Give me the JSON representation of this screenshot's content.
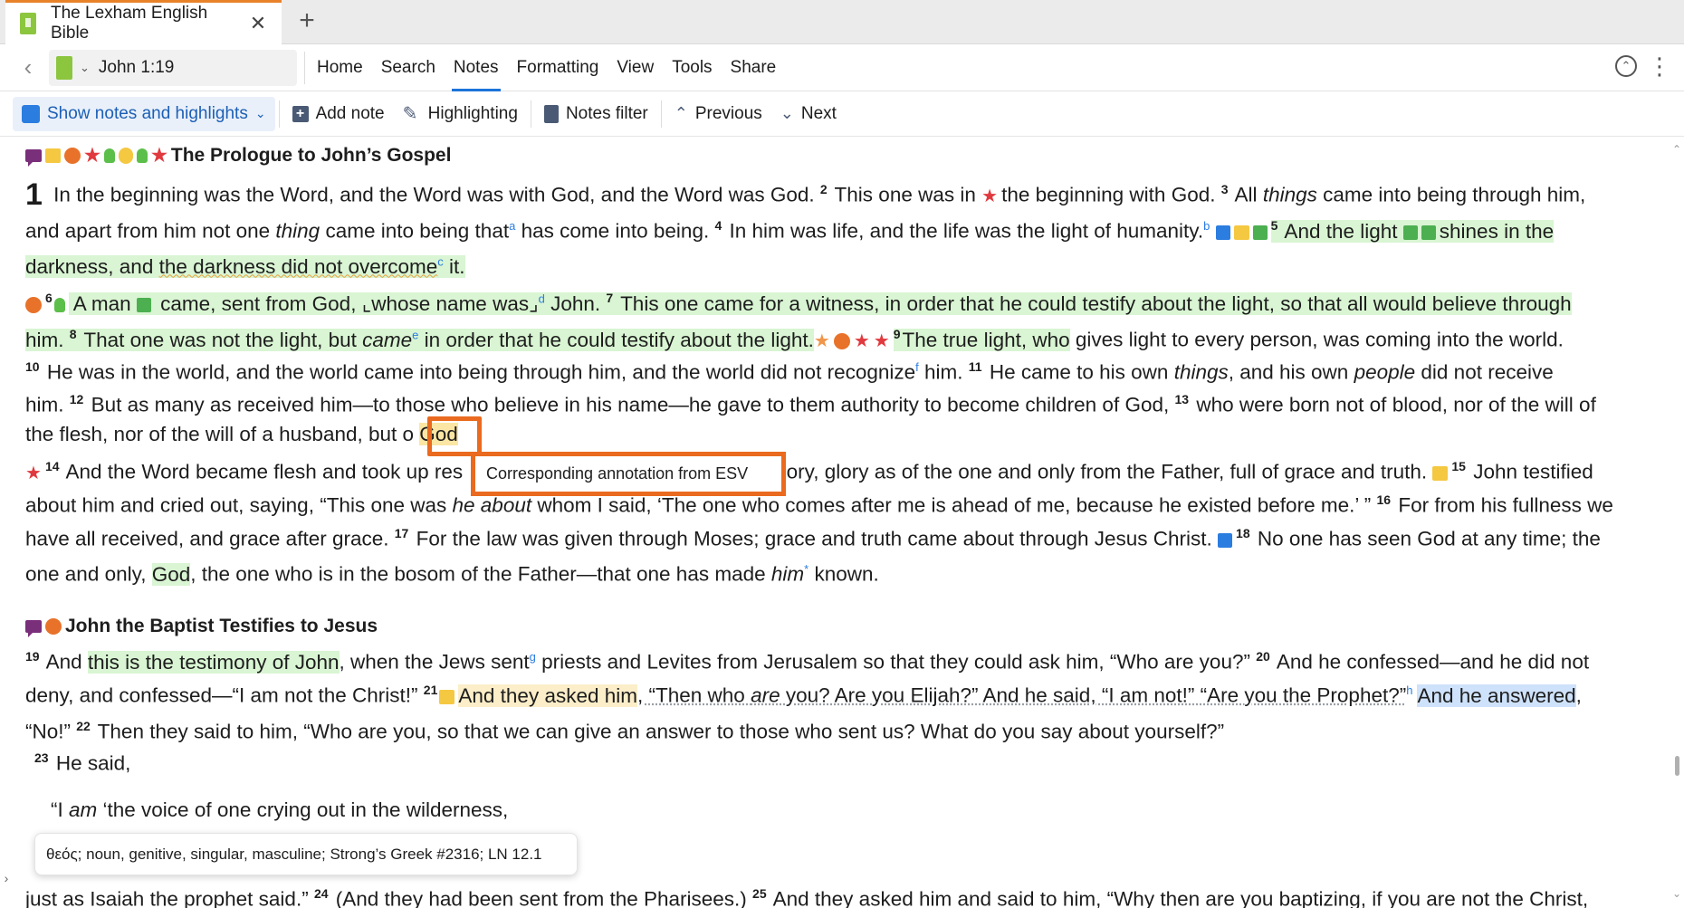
{
  "tab": {
    "title": "The Lexham English Bible",
    "close": "✕",
    "add": "+"
  },
  "nav": {
    "back": "‹",
    "reference": "John 1:19",
    "menu": [
      "Home",
      "Search",
      "Notes",
      "Formatting",
      "View",
      "Tools",
      "Share"
    ],
    "active_menu": "Notes"
  },
  "toolbar": {
    "show_notes": "Show notes and highlights",
    "add_note": "Add note",
    "highlighting": "Highlighting",
    "notes_filter": "Notes filter",
    "previous": "Previous",
    "next": "Next"
  },
  "icons": [
    "book-icon",
    "chevron-down-icon",
    "circle-up-icon",
    "kebab-icon",
    "notes-icon",
    "add-note-icon",
    "pen-icon",
    "filter-icon",
    "chevron-up-icon"
  ],
  "colors": {
    "accent": "#1c74d8",
    "focus": "#ea6a1f",
    "highlight_green": "#d9f5d3",
    "highlight_yellow": "#fbeec8",
    "highlight_blue": "#cfe2fb"
  },
  "text": {
    "h1": "The Prologue to John’s Gospel",
    "h2": "John the Baptist Testifies to Jesus",
    "ch": "1",
    "v2": "2",
    "v3": "3",
    "v4": "4",
    "v5": "5",
    "v6": "6",
    "v7": "7",
    "v8": "8",
    "v9": "9",
    "v10": "10",
    "v11": "11",
    "v12": "12",
    "v13": "13",
    "v14": "14",
    "v15": "15",
    "v16": "16",
    "v17": "17",
    "v18": "18",
    "v19": "19",
    "v20": "20",
    "v21": "21",
    "v22": "22",
    "v23": "23",
    "v24": "24",
    "v25": "25",
    "fa": "a",
    "fb": "b",
    "fc": "c",
    "fd": "d",
    "fe": "e",
    "ff": "f",
    "fg": "g",
    "fh": "h",
    "fstar": "*",
    "l1a": " In the beginning was the Word, and the Word was with God, and the Word was God. ",
    "l1b": " This one was in ",
    "l1c": "the beginning with God. ",
    "l1d": " All ",
    "l1e": "things",
    "l1f": " came into being through him,",
    "l2a": "and apart from him not one ",
    "l2b": "thing",
    "l2c": " came into being that",
    "l2d": " has come into being. ",
    "l2e": " In him was life, and the life was the light of humanity.",
    "l2f": " And the light ",
    "l2g": "shines in the",
    "l3a": "darkness, and ",
    "l3b": "the darkness did not overcome",
    "l3c": " it.",
    "l4a": " A man ",
    "l4b": " came, sent from God, ",
    "l4c": "⌞whose name was⌟",
    "l4d": " John. ",
    "l4e": " This one came for a witness, in order that he could testify about the light, so that all would believe through",
    "l5a": "him. ",
    "l5b": " That one was not the light, but ",
    "l5c": "came",
    "l5d": " in order that he could testify about the light.",
    "l5e": "The true light, who",
    "l5f": " gives light to every person, was coming into the world.",
    "l6a": " He was in the world, and the world came into being through him, and the world did not recognize",
    "l6b": " him. ",
    "l6c": " He came to his own ",
    "l6d": "things",
    "l6e": ", and his own ",
    "l6f": "people",
    "l6g": " did not receive",
    "l7a": "him. ",
    "l7b": " But as many as received him—to those who believe in his name—he gave to them authority to become children of God, ",
    "l7c": " who were born not of blood, nor of the will of",
    "l8a": "the flesh, nor of the will of a husband, but o",
    "l8b": "God",
    "l9a": " And the Word became flesh and took up res",
    "l9b": "glory, glory as of the one and only from the Father, full of grace and truth. ",
    "l9c": " John testified",
    "l10a": "about him and cried out, saying, “This one was ",
    "l10b": "he about",
    "l10c": " whom I said, ‘The one who comes after me is ahead of me, because he existed before me.’ ” ",
    "l10d": " For from his fullness we",
    "l11a": "have all received, and grace after grace. ",
    "l11b": " For the law was given through Moses; grace and truth came about through Jesus Christ. ",
    "l11c": " No one has seen God at any time; the",
    "l12a": "one and only, ",
    "l12b": "God",
    "l12c": ", the one who is in the bosom of the Father—that one has made ",
    "l12d": "him",
    "l12e": " known.",
    "l13a": " And ",
    "l13b": "this is the testimony of John",
    "l13c": ", when the Jews sent",
    "l13d": " priests and Levites from Jerusalem so that they could ask him, “Who are you?” ",
    "l13e": " And he confessed—and he did not",
    "l14a": "deny, and confessed—“I am not the Christ!” ",
    "l14b": "And they asked him",
    "l14c": ", “Then who ",
    "l14d": "are",
    "l14e": " you? Are you Elijah?” And he said, “I am not!” “Are you the Prophet?”",
    "l14f": " ",
    "l14g": "And he answered",
    "l14h": ",",
    "l15a": "“No!” ",
    "l15b": " Then they said to him, “Who are you, so that we can give an answer to those who sent us? What do you say about yourself?”",
    "l16a": " He said,",
    "l17a": "“I ",
    "l17b": "am",
    "l17c": " ‘the voice of one crying out in the wilderness,",
    "l18a": "just as Isaiah the prophet said.” ",
    "l18b": " (And they had been sent from the Pharisees.) ",
    "l18c": " And they asked him and said to him, “Why then are you baptizing, if you are not the Christ,"
  },
  "tooltip": "Corresponding annotation from ESV",
  "morph": "θεός; noun, genitive, singular, masculine; Strong’s Greek #2316; LN 12.1"
}
